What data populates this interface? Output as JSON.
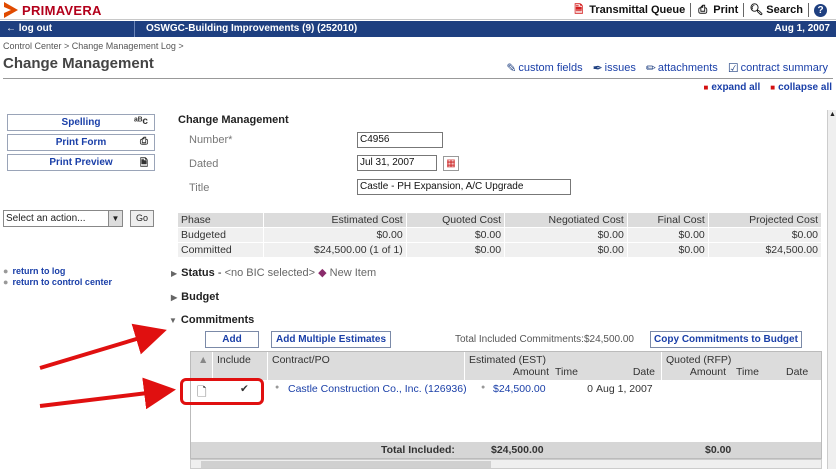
{
  "brand": {
    "name": "PRIMAVERA"
  },
  "top_links": {
    "transmittal": "Transmittal Queue",
    "print": "Print",
    "search": "Search",
    "help_icon": "help-icon"
  },
  "bluebar": {
    "logout": "log out",
    "project": "OSWGC-Building Improvements (9) (252010)",
    "date": "Aug 1, 2007"
  },
  "breadcrumb": "Control Center > Change Management Log >",
  "page_title": "Change Management",
  "tool_links": {
    "custom_fields": "custom fields",
    "issues": "issues",
    "attachments": "attachments",
    "contract_summary": "contract summary"
  },
  "expand": {
    "expand_all": "expand all",
    "collapse_all": "collapse all"
  },
  "left_panel": {
    "spelling": "Spelling",
    "spelling_badge": "ᵃᴮᴄ",
    "print_form": "Print Form",
    "print_preview": "Print Preview",
    "action_select": "Select an action...",
    "go": "Go",
    "return_log": "return to log",
    "return_control": "return to control center"
  },
  "form": {
    "section": "Change Management",
    "number_label": "Number*",
    "number_value": "C4956",
    "dated_label": "Dated",
    "dated_value": "Jul 31, 2007",
    "title_label": "Title",
    "title_value": "Castle - PH Expansion, A/C Upgrade"
  },
  "cost_table": {
    "headers": [
      "Phase",
      "Estimated Cost",
      "Quoted Cost",
      "Negotiated Cost",
      "Final Cost",
      "Projected Cost"
    ],
    "rows": [
      [
        "Budgeted",
        "$0.00",
        "$0.00",
        "$0.00",
        "$0.00",
        "$0.00"
      ],
      [
        "Committed",
        "$24,500.00 (1 of 1)",
        "$0.00",
        "$0.00",
        "$0.00",
        "$24,500.00"
      ]
    ]
  },
  "status": {
    "label": "Status",
    "dash": " - ",
    "bic": "<no BIC selected>",
    "new_item": "New Item"
  },
  "budget": {
    "label": "Budget"
  },
  "commitments": {
    "label": "Commitments",
    "add": "Add",
    "add_multiple": "Add Multiple Estimates",
    "total_included_text": "Total Included Commitments:$24,500.00",
    "copy": "Copy Commitments to Budget",
    "columns": {
      "include": "Include",
      "contract": "Contract/PO",
      "est_top": "Estimated (EST)",
      "est_amount": "Amount",
      "est_time": "Time",
      "est_date": "Date",
      "quoted_top": "Quoted (RFP)",
      "quoted_amount": "Amount",
      "quoted_time": "Time",
      "quoted_date": "Date"
    },
    "row": {
      "included": "✔",
      "contract": "Castle Construction Co., Inc. (126936)",
      "est_amount": "$24,500.00",
      "est_time": "0",
      "est_date": "Aug 1, 2007"
    },
    "footer": {
      "label": "Total Included:",
      "est_total": "$24,500.00",
      "quoted_total": "$0.00"
    }
  },
  "colors": {
    "brand_red": "#b3001b",
    "nav_blue": "#1e3f80",
    "link_blue": "#1a3fa8",
    "annotation_red": "#e01010"
  }
}
